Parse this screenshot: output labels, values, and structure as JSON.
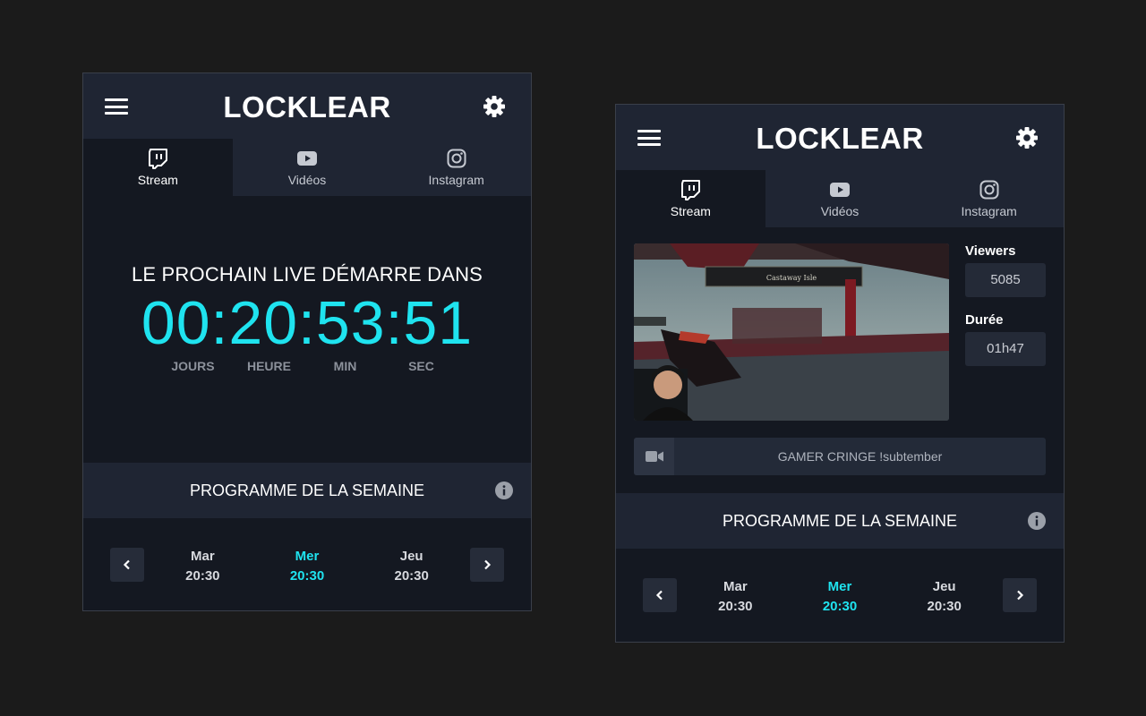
{
  "colors": {
    "accent": "#1fe3ef",
    "panel_bg": "#141821",
    "header_bg": "#1f2533",
    "page_bg": "#1b1b1b"
  },
  "brand": {
    "logo_text": "LOCKLEAR"
  },
  "tabs": [
    {
      "label": "Stream",
      "icon": "twitch-icon",
      "active": true
    },
    {
      "label": "Vidéos",
      "icon": "youtube-icon",
      "active": false
    },
    {
      "label": "Instagram",
      "icon": "instagram-icon",
      "active": false
    }
  ],
  "offline_panel": {
    "countdown": {
      "title": "LE PROCHAIN LIVE DÉMARRE DANS",
      "time": "00:20:53:51",
      "units": [
        "JOURS",
        "HEURE",
        "MIN",
        "SEC"
      ]
    }
  },
  "live_panel": {
    "stats": {
      "viewers_label": "Viewers",
      "viewers_value": "5085",
      "duration_label": "Durée",
      "duration_value": "01h47"
    },
    "video": {
      "overlay_text": "Castaway Isle"
    },
    "game_title": "GAMER CRINGE !subtember"
  },
  "schedule": {
    "title": "PROGRAMME DE LA SEMAINE",
    "days": [
      {
        "day": "Mar",
        "time": "20:30",
        "active": false
      },
      {
        "day": "Mer",
        "time": "20:30",
        "active": true
      },
      {
        "day": "Jeu",
        "time": "20:30",
        "active": false
      }
    ]
  }
}
